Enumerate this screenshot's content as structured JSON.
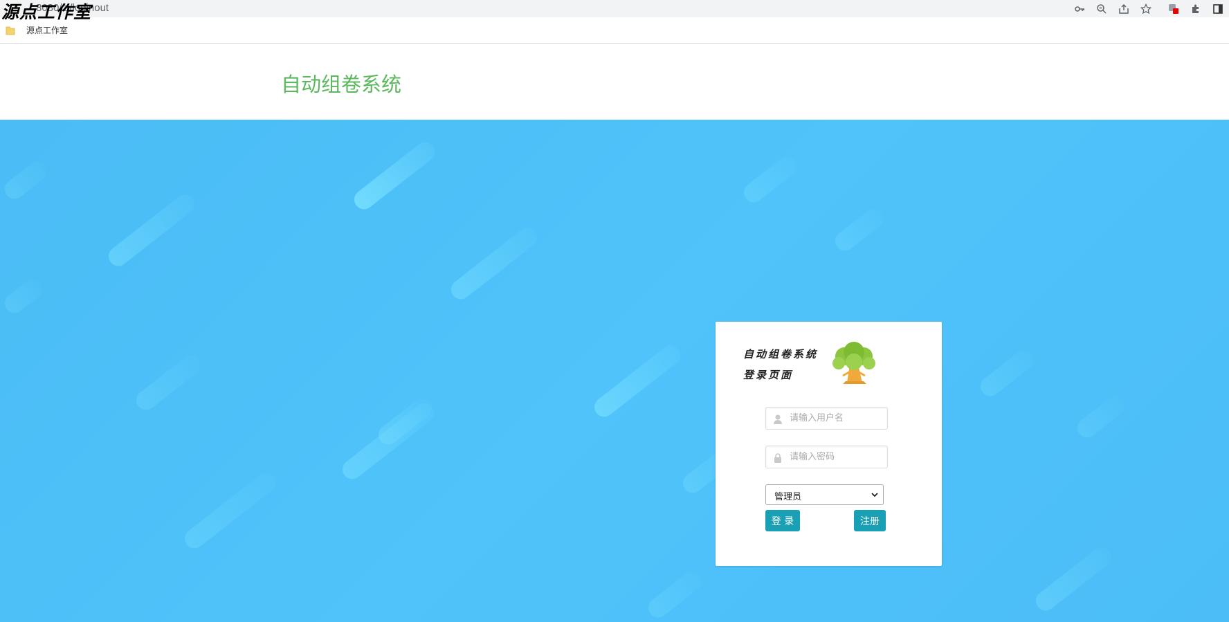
{
  "browser": {
    "watermark": "源点工作室",
    "url": "localhost:8080/zj/loginout",
    "url_visible": "8080/zj/loginout",
    "icons": [
      "key-icon",
      "zoom-out-icon",
      "share-icon",
      "star-icon",
      "profile-icon",
      "extensions-icon",
      "sidebar-icon"
    ],
    "bookmark_label": "源点工作室"
  },
  "header": {
    "site_title": "自动组卷系统",
    "title_color": "#5cb85c"
  },
  "login": {
    "logo_line1": "自动组卷系统",
    "logo_line2": "登录页面",
    "username_placeholder": "请输入用户名",
    "password_placeholder": "请输入密码",
    "role_selected": "管理员",
    "login_button": "登 录",
    "register_button": "注册",
    "button_color": "#1aa0b4"
  },
  "colors": {
    "background": "#4cbff8",
    "card": "#ffffff"
  }
}
